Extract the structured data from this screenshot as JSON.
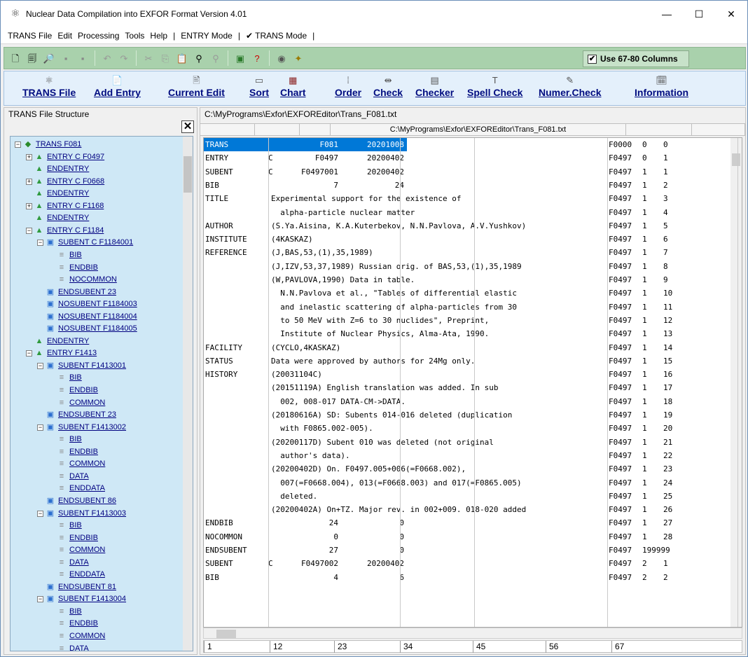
{
  "window": {
    "title": "Nuclear Data Compilation into EXFOR Format Version 4.01",
    "minimize": "—",
    "maximize": "☐",
    "close": "✕"
  },
  "menu": [
    "TRANS File",
    "Edit",
    "Processing",
    "Tools",
    "Help",
    "|",
    "ENTRY Mode",
    "|",
    "✔ TRANS Mode",
    "|"
  ],
  "toolbar": {
    "use_columns_label": "Use 67-80 Columns",
    "use_columns_checked": "✔"
  },
  "bigbar": {
    "trans_file": "TRANS File",
    "add_entry": "Add Entry",
    "current_edit": "Current Edit",
    "sort": "Sort",
    "chart": "Chart",
    "order": "Order",
    "check": "Check",
    "checker": "Checker",
    "spell_check": "Spell Check",
    "numer_check": "Numer.Check",
    "information": "Information"
  },
  "left": {
    "legend": "TRANS File Structure",
    "close": "✕",
    "tree": [
      {
        "t": "TRANS     F081",
        "i": "book",
        "pm": "−",
        "l": 0
      },
      {
        "t": "ENTRY   C   F0497",
        "i": "tri",
        "pm": "+",
        "l": 1
      },
      {
        "t": "ENDENTRY",
        "i": "tri",
        "pm": "",
        "l": 1
      },
      {
        "t": "ENTRY   C   F0668",
        "i": "tri",
        "pm": "+",
        "l": 1
      },
      {
        "t": "ENDENTRY",
        "i": "tri",
        "pm": "",
        "l": 1
      },
      {
        "t": "ENTRY   C   F1168",
        "i": "tri",
        "pm": "+",
        "l": 1
      },
      {
        "t": "ENDENTRY",
        "i": "tri",
        "pm": "",
        "l": 1
      },
      {
        "t": "ENTRY   C   F1184",
        "i": "tri",
        "pm": "−",
        "l": 1
      },
      {
        "t": "SUBENT   C  F1184001",
        "i": "sub",
        "pm": "−",
        "l": 2
      },
      {
        "t": "BIB",
        "i": "doc",
        "pm": "",
        "l": 3
      },
      {
        "t": "ENDBIB",
        "i": "doc",
        "pm": "",
        "l": 3
      },
      {
        "t": "NOCOMMON",
        "i": "doc",
        "pm": "",
        "l": 3
      },
      {
        "t": "ENDSUBENT        23",
        "i": "sub",
        "pm": "",
        "l": 2
      },
      {
        "t": "NOSUBENT      F1184003",
        "i": "sub",
        "pm": "",
        "l": 2
      },
      {
        "t": "NOSUBENT      F1184004",
        "i": "sub",
        "pm": "",
        "l": 2
      },
      {
        "t": "NOSUBENT      F1184005",
        "i": "sub",
        "pm": "",
        "l": 2
      },
      {
        "t": "ENDENTRY",
        "i": "tri",
        "pm": "",
        "l": 1
      },
      {
        "t": "ENTRY         F1413",
        "i": "tri",
        "pm": "−",
        "l": 1
      },
      {
        "t": "SUBENT       F1413001",
        "i": "sub",
        "pm": "−",
        "l": 2
      },
      {
        "t": "BIB",
        "i": "doc",
        "pm": "",
        "l": 3
      },
      {
        "t": "ENDBIB",
        "i": "doc",
        "pm": "",
        "l": 3
      },
      {
        "t": "COMMON",
        "i": "doc",
        "pm": "",
        "l": 3
      },
      {
        "t": "ENDSUBENT        23",
        "i": "sub",
        "pm": "",
        "l": 2
      },
      {
        "t": "SUBENT       F1413002",
        "i": "sub",
        "pm": "−",
        "l": 2
      },
      {
        "t": "BIB",
        "i": "doc",
        "pm": "",
        "l": 3
      },
      {
        "t": "ENDBIB",
        "i": "doc",
        "pm": "",
        "l": 3
      },
      {
        "t": "COMMON",
        "i": "doc",
        "pm": "",
        "l": 3
      },
      {
        "t": "DATA",
        "i": "doc",
        "pm": "",
        "l": 3
      },
      {
        "t": "ENDDATA",
        "i": "doc",
        "pm": "",
        "l": 3
      },
      {
        "t": "ENDSUBENT        86",
        "i": "sub",
        "pm": "",
        "l": 2
      },
      {
        "t": "SUBENT       F1413003",
        "i": "sub",
        "pm": "−",
        "l": 2
      },
      {
        "t": "BIB",
        "i": "doc",
        "pm": "",
        "l": 3
      },
      {
        "t": "ENDBIB",
        "i": "doc",
        "pm": "",
        "l": 3
      },
      {
        "t": "COMMON",
        "i": "doc",
        "pm": "",
        "l": 3
      },
      {
        "t": "DATA",
        "i": "doc",
        "pm": "",
        "l": 3
      },
      {
        "t": "ENDDATA",
        "i": "doc",
        "pm": "",
        "l": 3
      },
      {
        "t": "ENDSUBENT        81",
        "i": "sub",
        "pm": "",
        "l": 2
      },
      {
        "t": "SUBENT       F1413004",
        "i": "sub",
        "pm": "−",
        "l": 2
      },
      {
        "t": "BIB",
        "i": "doc",
        "pm": "",
        "l": 3
      },
      {
        "t": "ENDBIB",
        "i": "doc",
        "pm": "",
        "l": 3
      },
      {
        "t": "COMMON",
        "i": "doc",
        "pm": "",
        "l": 3
      },
      {
        "t": "DATA",
        "i": "doc",
        "pm": "",
        "l": 3
      }
    ]
  },
  "right": {
    "legend": "C:\\MyPrograms\\Exfor\\EXFOREditor\\Trans_F081.txt",
    "header_path": "C:\\MyPrograms\\Exfor\\EXFOREditor\\Trans_F081.txt",
    "rows": [
      [
        "TRANS",
        "",
        "F081",
        "20201008",
        "",
        "",
        "",
        "F0000",
        "0",
        "0"
      ],
      [
        "ENTRY",
        "C",
        "F0497",
        "20200402",
        "",
        "",
        "",
        "F0497",
        "0",
        "1"
      ],
      [
        "SUBENT",
        "C",
        "F0497001",
        "20200402",
        "",
        "",
        "",
        "F0497",
        "1",
        "1"
      ],
      [
        "BIB",
        "",
        "7",
        "24",
        "",
        "",
        "",
        "F0497",
        "1",
        "2"
      ],
      [
        "TITLE",
        "Experimental support for the existence of",
        "",
        "",
        "",
        "",
        "",
        "F0497",
        "1",
        "3"
      ],
      [
        "",
        "  alpha-particle nuclear matter",
        "",
        "",
        "",
        "",
        "",
        "F0497",
        "1",
        "4"
      ],
      [
        "AUTHOR",
        "(S.Ya.Aisina, K.A.Kuterbekov, N.N.Pavlova, A.V.Yushkov)",
        "",
        "",
        "",
        "",
        "",
        "F0497",
        "1",
        "5"
      ],
      [
        "INSTITUTE",
        "(4KASKAZ)",
        "",
        "",
        "",
        "",
        "",
        "F0497",
        "1",
        "6"
      ],
      [
        "REFERENCE",
        "(J,BAS,53,(1),35,1989)",
        "",
        "",
        "",
        "",
        "",
        "F0497",
        "1",
        "7"
      ],
      [
        "",
        "(J,IZV,53,37,1989) Russian orig. of BAS,53,(1),35,1989",
        "",
        "",
        "",
        "",
        "",
        "F0497",
        "1",
        "8"
      ],
      [
        "",
        "(W,PAVLOVA,1990) Data in table.",
        "",
        "",
        "",
        "",
        "",
        "F0497",
        "1",
        "9"
      ],
      [
        "",
        "  N.N.Pavlova et al., \"Tables of differential elastic",
        "",
        "",
        "",
        "",
        "",
        "F0497",
        "1",
        "10"
      ],
      [
        "",
        "  and inelastic scattering of alpha-particles from 30",
        "",
        "",
        "",
        "",
        "",
        "F0497",
        "1",
        "11"
      ],
      [
        "",
        "  to 50 MeV with Z=6 to 30 nuclides\", Preprint,",
        "",
        "",
        "",
        "",
        "",
        "F0497",
        "1",
        "12"
      ],
      [
        "",
        "  Institute of Nuclear Physics, Alma-Ata, 1990.",
        "",
        "",
        "",
        "",
        "",
        "F0497",
        "1",
        "13"
      ],
      [
        "FACILITY",
        "(CYCLO,4KASKAZ)",
        "",
        "",
        "",
        "",
        "",
        "F0497",
        "1",
        "14"
      ],
      [
        "STATUS",
        "Data were approved by authors for 24Mg only.",
        "",
        "",
        "",
        "",
        "",
        "F0497",
        "1",
        "15"
      ],
      [
        "HISTORY",
        "(20031104C)",
        "",
        "",
        "",
        "",
        "",
        "F0497",
        "1",
        "16"
      ],
      [
        "",
        "(20151119A) English translation was added. In sub",
        "",
        "",
        "",
        "",
        "",
        "F0497",
        "1",
        "17"
      ],
      [
        "",
        "  002, 008-017 DATA-CM->DATA.",
        "",
        "",
        "",
        "",
        "",
        "F0497",
        "1",
        "18"
      ],
      [
        "",
        "(20180616A) SD: Subents 014-016 deleted (duplication",
        "",
        "",
        "",
        "",
        "",
        "F0497",
        "1",
        "19"
      ],
      [
        "",
        "  with F0865.002-005).",
        "",
        "",
        "",
        "",
        "",
        "F0497",
        "1",
        "20"
      ],
      [
        "",
        "(20200117D) Subent 010 was deleted (not original",
        "",
        "",
        "",
        "",
        "",
        "F0497",
        "1",
        "21"
      ],
      [
        "",
        "  author's data).",
        "",
        "",
        "",
        "",
        "",
        "F0497",
        "1",
        "22"
      ],
      [
        "",
        "(20200402D) On. F0497.005+006(=F0668.002),",
        "",
        "",
        "",
        "",
        "",
        "F0497",
        "1",
        "23"
      ],
      [
        "",
        "  007(=F0668.004), 013(=F0668.003) and 017(=F0865.005)",
        "",
        "",
        "",
        "",
        "",
        "F0497",
        "1",
        "24"
      ],
      [
        "",
        "  deleted.",
        "",
        "",
        "",
        "",
        "",
        "F0497",
        "1",
        "25"
      ],
      [
        "",
        "(20200402A) On+TZ. Major rev. in 002+009. 018-020 added",
        "",
        "",
        "",
        "",
        "",
        "F0497",
        "1",
        "26"
      ],
      [
        "ENDBIB",
        "",
        "24",
        "0",
        "",
        "",
        "",
        "F0497",
        "1",
        "27"
      ],
      [
        "NOCOMMON",
        "",
        "0",
        "0",
        "",
        "",
        "",
        "F0497",
        "1",
        "28"
      ],
      [
        "ENDSUBENT",
        "",
        "27",
        "0",
        "",
        "",
        "",
        "F0497",
        "199999",
        ""
      ],
      [
        "SUBENT",
        "C",
        "F0497002",
        "20200402",
        "",
        "",
        "",
        "F0497",
        "2",
        "1"
      ],
      [
        "BIB",
        "",
        "4",
        "6",
        "",
        "",
        "",
        "F0497",
        "2",
        "2"
      ]
    ],
    "ruler": [
      "1",
      "12",
      "23",
      "34",
      "45",
      "56",
      "67"
    ]
  }
}
